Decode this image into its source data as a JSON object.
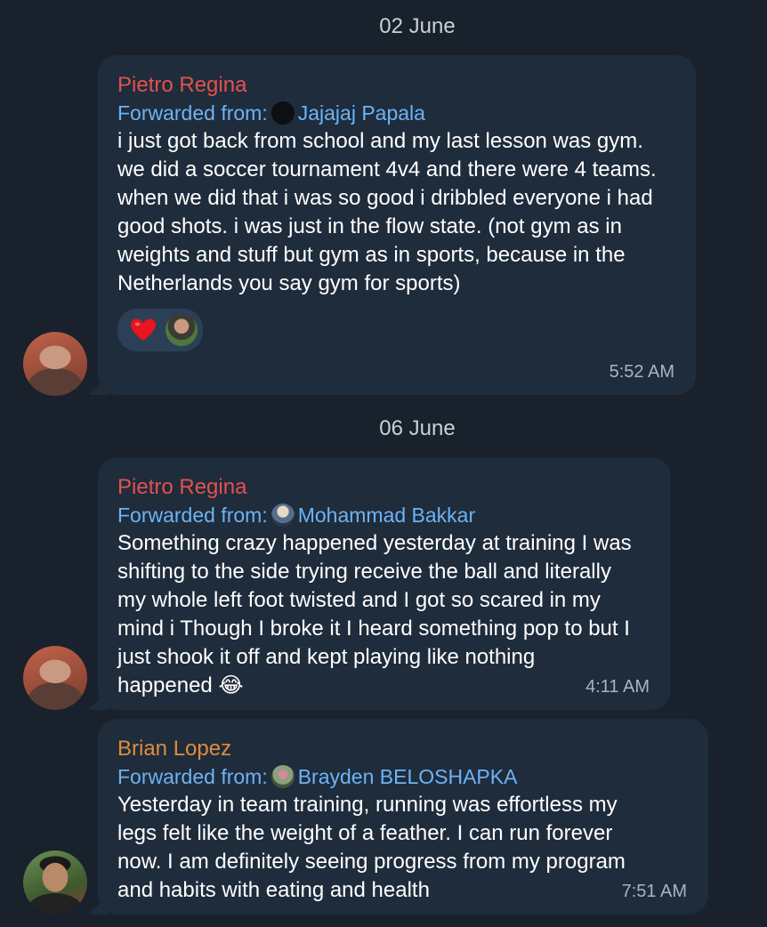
{
  "dates": [
    "02 June",
    "06 June"
  ],
  "messages": [
    {
      "sender": "Pietro Regina",
      "forward_prefix": "Forwarded from:",
      "forward_name": "Jajajaj Papala",
      "text": "i just got back from school and my last lesson was gym. we did a soccer tournament 4v4 and there were 4 teams. when we did that i was so good i dribbled everyone i had good shots. i was just in the flow state. (not gym as in weights and stuff but gym as in sports, because in the Netherlands you say gym for sports)",
      "time": "5:52 AM",
      "reaction": "❤️"
    },
    {
      "sender": "Pietro Regina",
      "forward_prefix": "Forwarded from:",
      "forward_name": "Mohammad Bakkar",
      "text": "Something crazy happened yesterday at training I was shifting to the side trying receive the ball and literally my whole left foot twisted and I got so scared in my mind i Though I broke it I heard something pop to but I just shook it off and kept playing like nothing happened 😂",
      "time": "4:11 AM"
    },
    {
      "sender": "Brian Lopez",
      "forward_prefix": "Forwarded from:",
      "forward_name": "Brayden BELOSHAPKA",
      "text": "Yesterday in team training, running was effortless my legs felt like the weight of a feather. I can run forever now. I am definitely seeing progress from my program and habits with eating and health",
      "time": "7:51 AM"
    }
  ],
  "colors": {
    "background": "#19212c",
    "bubble": "#1f2c3c",
    "sender_pietro": "#e3524e",
    "sender_brian": "#e08b3a",
    "forward": "#6db3f2",
    "time": "#aab4c0"
  }
}
